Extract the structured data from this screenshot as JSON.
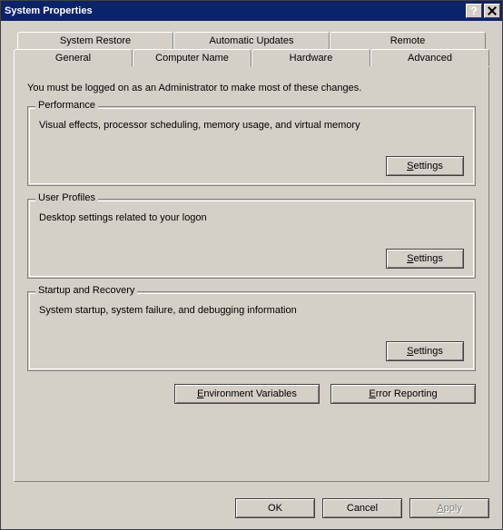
{
  "title": "System Properties",
  "tabs": {
    "row1": [
      "System Restore",
      "Automatic Updates",
      "Remote"
    ],
    "row2": [
      "General",
      "Computer Name",
      "Hardware",
      "Advanced"
    ],
    "active": "Advanced"
  },
  "intro": "You must be logged on as an Administrator to make most of these changes.",
  "groups": {
    "performance": {
      "title": "Performance",
      "desc": "Visual effects, processor scheduling, memory usage, and virtual memory",
      "button_prefix": "S",
      "button_rest": "ettings"
    },
    "userprofiles": {
      "title": "User Profiles",
      "desc": "Desktop settings related to your logon",
      "button_prefix": "S",
      "button_rest": "ettings"
    },
    "startup": {
      "title": "Startup and Recovery",
      "desc": "System startup, system failure, and debugging information",
      "button_prefix": "S",
      "button_rest": "ettings"
    }
  },
  "actions": {
    "env_prefix": "E",
    "env_rest": "nvironment Variables",
    "err_prefix": "E",
    "err_rest": "rror Reporting"
  },
  "footer": {
    "ok": "OK",
    "cancel": "Cancel",
    "apply_prefix": "A",
    "apply_rest": "pply"
  }
}
